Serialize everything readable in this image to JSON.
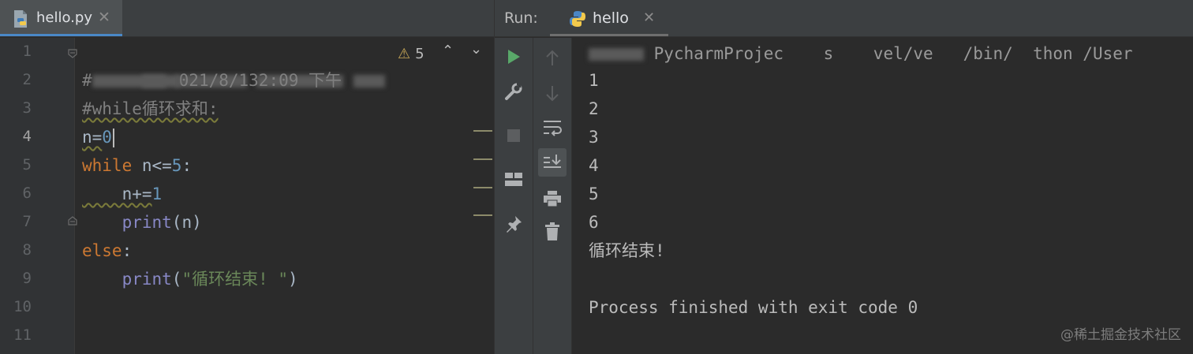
{
  "editor": {
    "tab": {
      "file_name": "hello.py",
      "close_symbol": "✕",
      "icon": "python-file-icon"
    },
    "line_numbers": [
      "1",
      "2",
      "3",
      "4",
      "5",
      "6",
      "7",
      "8",
      "9",
      "10",
      "11"
    ],
    "current_line": 4,
    "inspection": {
      "warnings": "5",
      "warning_icon": "⚠",
      "up": "⌃",
      "down": "⌄"
    },
    "lines": {
      "l2_visible": "021/8/132:09 下午",
      "l3": "#while循环求和:",
      "l4_var": "n=",
      "l4_num": "0",
      "l5_kw": "while",
      "l5_mid": " n<=",
      "l5_num": "5",
      "l5_end": ":",
      "l6_a": "    n+=",
      "l6_num": "1",
      "l7_fn": "    print",
      "l7_rest": "(n)",
      "l8_kw": "else",
      "l8_end": ":",
      "l9_fn": "    print",
      "l9_open": "(",
      "l9_str": "\"循环结束! \"",
      "l9_close": ")"
    }
  },
  "run": {
    "label": "Run:",
    "tab": {
      "name": "hello",
      "close_symbol": "✕",
      "icon": "python-icon"
    },
    "toolbar_left": [
      "run-icon",
      "wrench-icon",
      "stop-icon",
      "layout-icon",
      "pin-icon"
    ],
    "toolbar_right": [
      "arrow-up-icon",
      "arrow-down-icon",
      "soft-wrap-icon",
      "scroll-to-end-icon",
      "print-icon",
      "trash-icon"
    ],
    "console": {
      "path_visible": "PycharmProjec    s    vel/ve   /bin/  thon /User",
      "outputs": [
        "1",
        "2",
        "3",
        "4",
        "5",
        "6"
      ],
      "end_message": "循环结束!",
      "process": "Process finished with exit code 0"
    }
  },
  "watermark": "@稀土掘金技术社区",
  "colors": {
    "keyword": "#cc7832",
    "number": "#6897bb",
    "string": "#6a8759",
    "builtin": "#8888c6",
    "run_green": "#59a869"
  }
}
